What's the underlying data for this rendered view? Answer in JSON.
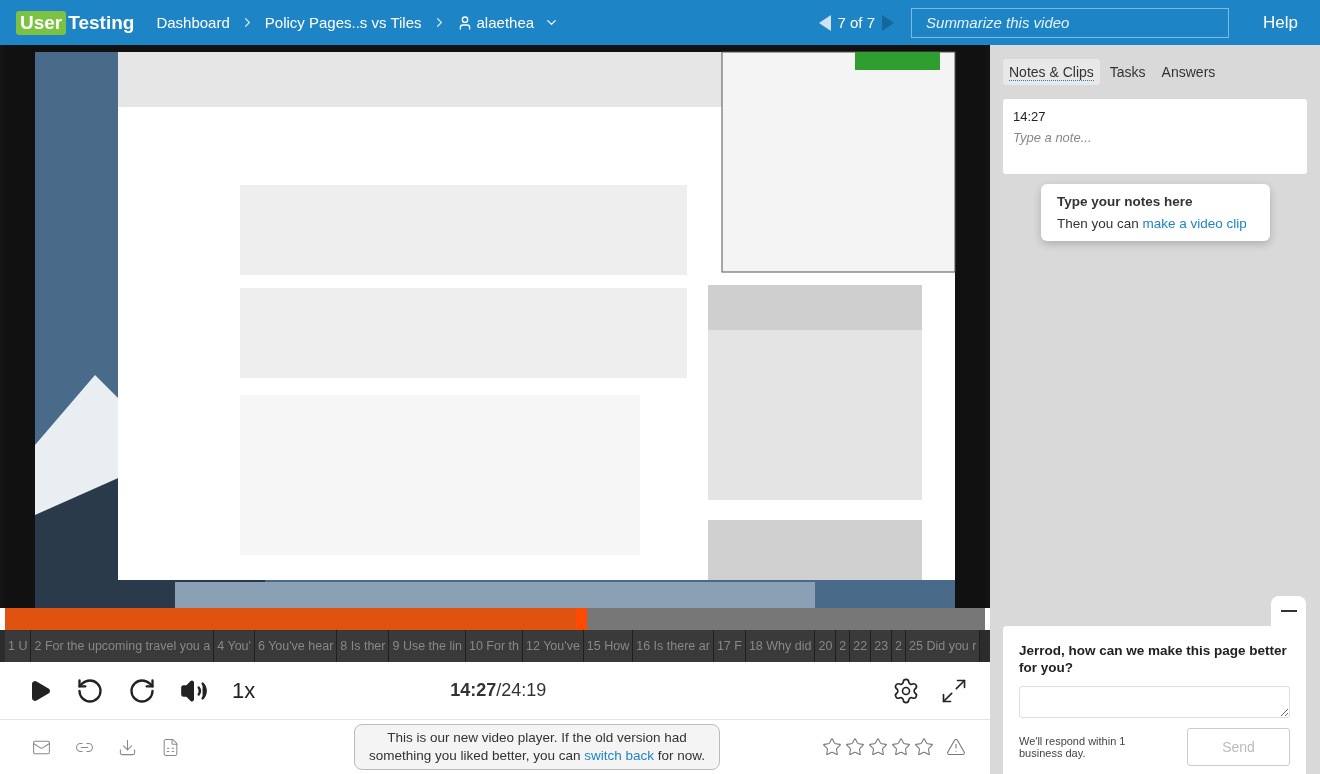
{
  "top_bar": {
    "logo": {
      "part1": "User",
      "part2": "Testing"
    },
    "breadcrumbs": [
      {
        "label": "Dashboard"
      },
      {
        "label": "Policy Pages..s vs Tiles"
      },
      {
        "label": "alaethea",
        "kind": "user"
      }
    ],
    "pager": "7 of 7",
    "summarize": {
      "placeholder": "Summarize this video"
    },
    "help": "Help"
  },
  "progress": {
    "level": 0.594
  },
  "chapters": [
    {
      "label": "1 U"
    },
    {
      "label": "2 For the upcoming travel you a"
    },
    {
      "label": "4 You'"
    },
    {
      "label": "6 You've hear"
    },
    {
      "label": "8 Is ther"
    },
    {
      "label": "9 Use the lin"
    },
    {
      "label": "10 For th"
    },
    {
      "label": "12 You've"
    },
    {
      "label": "15 How"
    },
    {
      "label": "16 Is there ar"
    },
    {
      "label": "17 F"
    },
    {
      "label": "18 Why did"
    },
    {
      "label": "20"
    },
    {
      "label": "2"
    },
    {
      "label": "22"
    },
    {
      "label": "23"
    },
    {
      "label": "2"
    },
    {
      "label": "25 Did you r"
    }
  ],
  "controls": {
    "speed": "1x",
    "time_current": "14:27",
    "time_total": "/24:19"
  },
  "footer": {
    "notice": "This is our new video player. If the old version had something you liked better, you can ",
    "notice_link": "switch back",
    "notice_end": " for now.",
    "stars": 0
  },
  "side_panel": {
    "tabs": [
      {
        "label": "Notes & Clips",
        "selected": true
      },
      {
        "label": "Tasks",
        "selected": false
      },
      {
        "label": "Answers",
        "selected": false
      }
    ],
    "note": {
      "time": "14:27",
      "placeholder": "Type a note..."
    },
    "tooltip": {
      "title": "Type your notes here",
      "text": "Then you can ",
      "link": "make a video clip"
    },
    "feedback": {
      "question": "Jerrod, how can we make this page better for you?",
      "note": "We'll respond within 1 business day.",
      "send": "Send",
      "send_disabled": true
    }
  }
}
